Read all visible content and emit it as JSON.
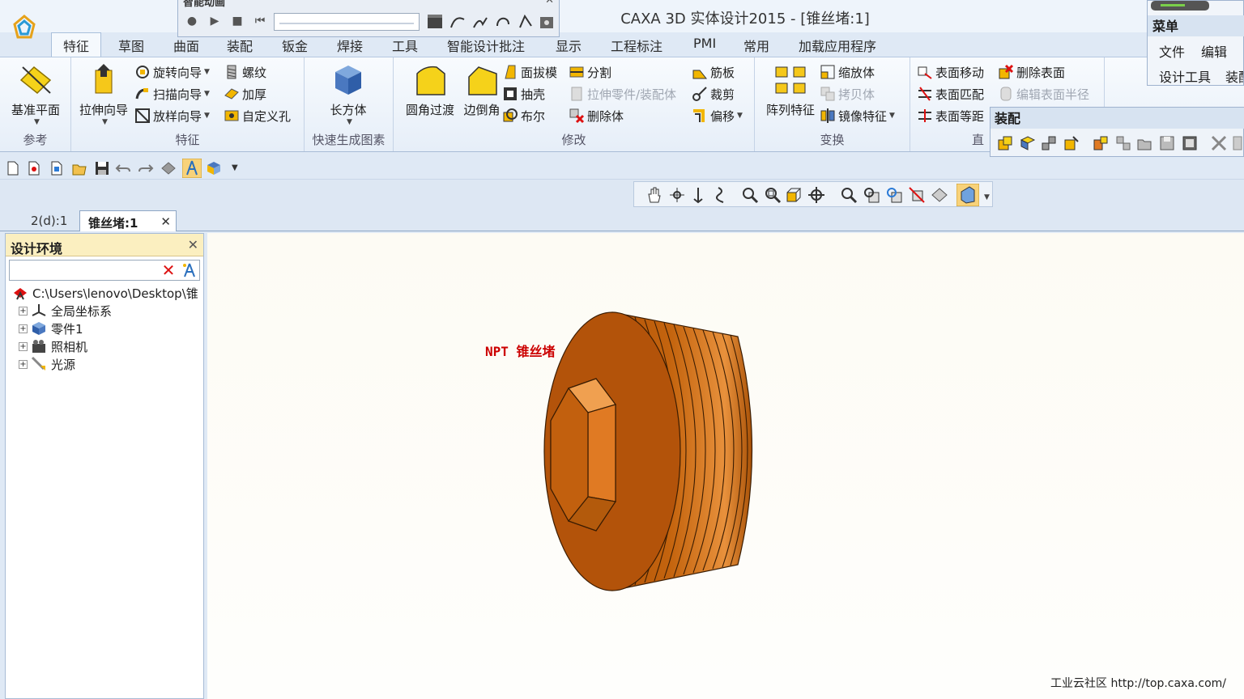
{
  "window": {
    "title": "CAXA 3D 实体设计2015 - [锥丝堵:1]"
  },
  "animation_toolbar": {
    "title": "智能动画"
  },
  "menu_tabs": [
    {
      "label": "特征",
      "active": true
    },
    {
      "label": "草图"
    },
    {
      "label": "曲面"
    },
    {
      "label": "装配"
    },
    {
      "label": "钣金"
    },
    {
      "label": "焊接"
    },
    {
      "label": "工具"
    },
    {
      "label": "智能设计批注"
    },
    {
      "label": "显示"
    },
    {
      "label": "工程标注"
    },
    {
      "label": "PMI"
    },
    {
      "label": "常用"
    },
    {
      "label": "加载应用程序"
    }
  ],
  "ribbon": {
    "reference": {
      "label": "参考",
      "plane": "基准平面"
    },
    "feature": {
      "label": "特征",
      "extrude": "拉伸向导",
      "revolve": "旋转向导",
      "sweep": "扫描向导",
      "loft": "放样向导",
      "thread": "螺纹",
      "thicken": "加厚",
      "custom_hole": "自定义孔"
    },
    "quick": {
      "label": "快速生成图素",
      "box": "长方体"
    },
    "modify": {
      "label": "修改",
      "fillet": "圆角过渡",
      "chamfer": "边倒角",
      "draft": "面拔模",
      "split": "分割",
      "shell": "抽壳",
      "extrude_part": "拉伸零件/装配体",
      "boolean": "布尔",
      "delete_body": "删除体",
      "rib": "筋板",
      "trim": "裁剪",
      "offset": "偏移"
    },
    "transform": {
      "label": "变换",
      "pattern": "阵列特征",
      "scale": "缩放体",
      "copy": "拷贝体",
      "mirror": "镜像特征"
    },
    "direct": {
      "label": "直",
      "move_face": "表面移动",
      "match_face": "表面匹配",
      "offset_face": "表面等距",
      "delete_face": "删除表面",
      "edit_radius": "编辑表面半径"
    }
  },
  "menu_panel": {
    "title": "菜单",
    "items": [
      "文件",
      "编辑",
      "设计工具",
      "装配"
    ]
  },
  "assembly_panel": {
    "title": "装配"
  },
  "doc_tabs": [
    {
      "label": "2(d):1"
    },
    {
      "label": "锥丝堵:1",
      "active": true
    }
  ],
  "design_panel": {
    "title": "设计环境",
    "search_placeholder": "",
    "root_path": "C:\\Users\\lenovo\\Desktop\\锥",
    "nodes": [
      {
        "label": "全局坐标系",
        "icon": "axis-icon"
      },
      {
        "label": "零件1",
        "icon": "part-icon"
      },
      {
        "label": "照相机",
        "icon": "camera-icon"
      },
      {
        "label": "光源",
        "icon": "light-icon"
      }
    ]
  },
  "viewport": {
    "model_label": "NPT 锥丝堵",
    "watermark": "工业云社区 http://top.caxa.com/"
  },
  "colors": {
    "model_body": "#b3530a",
    "model_hex": "#e07a23",
    "label": "#cc0000",
    "panel_header": "#fbefc0"
  }
}
